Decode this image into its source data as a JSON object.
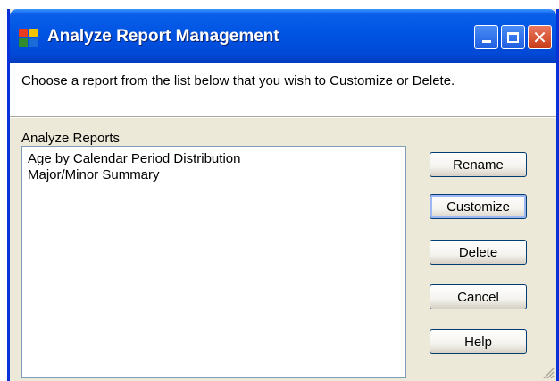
{
  "window": {
    "title": "Analyze Report Management",
    "icons": {
      "app": "app-icon",
      "minimize": "minimize-icon",
      "maximize": "maximize-icon",
      "close": "close-icon"
    }
  },
  "instructions": "Choose a report from the list below that you wish to Customize or Delete.",
  "reports": {
    "label": "Analyze Reports",
    "items": [
      "Age by Calendar Period Distribution",
      "Major/Minor Summary"
    ]
  },
  "buttons": {
    "rename": "Rename",
    "customize": "Customize",
    "delete": "Delete",
    "cancel": "Cancel",
    "help": "Help"
  },
  "colors": {
    "title_bar": "#0054e3",
    "dialog_bg": "#ece9d8",
    "button_border": "#003c74",
    "close_button": "#c93b17"
  }
}
